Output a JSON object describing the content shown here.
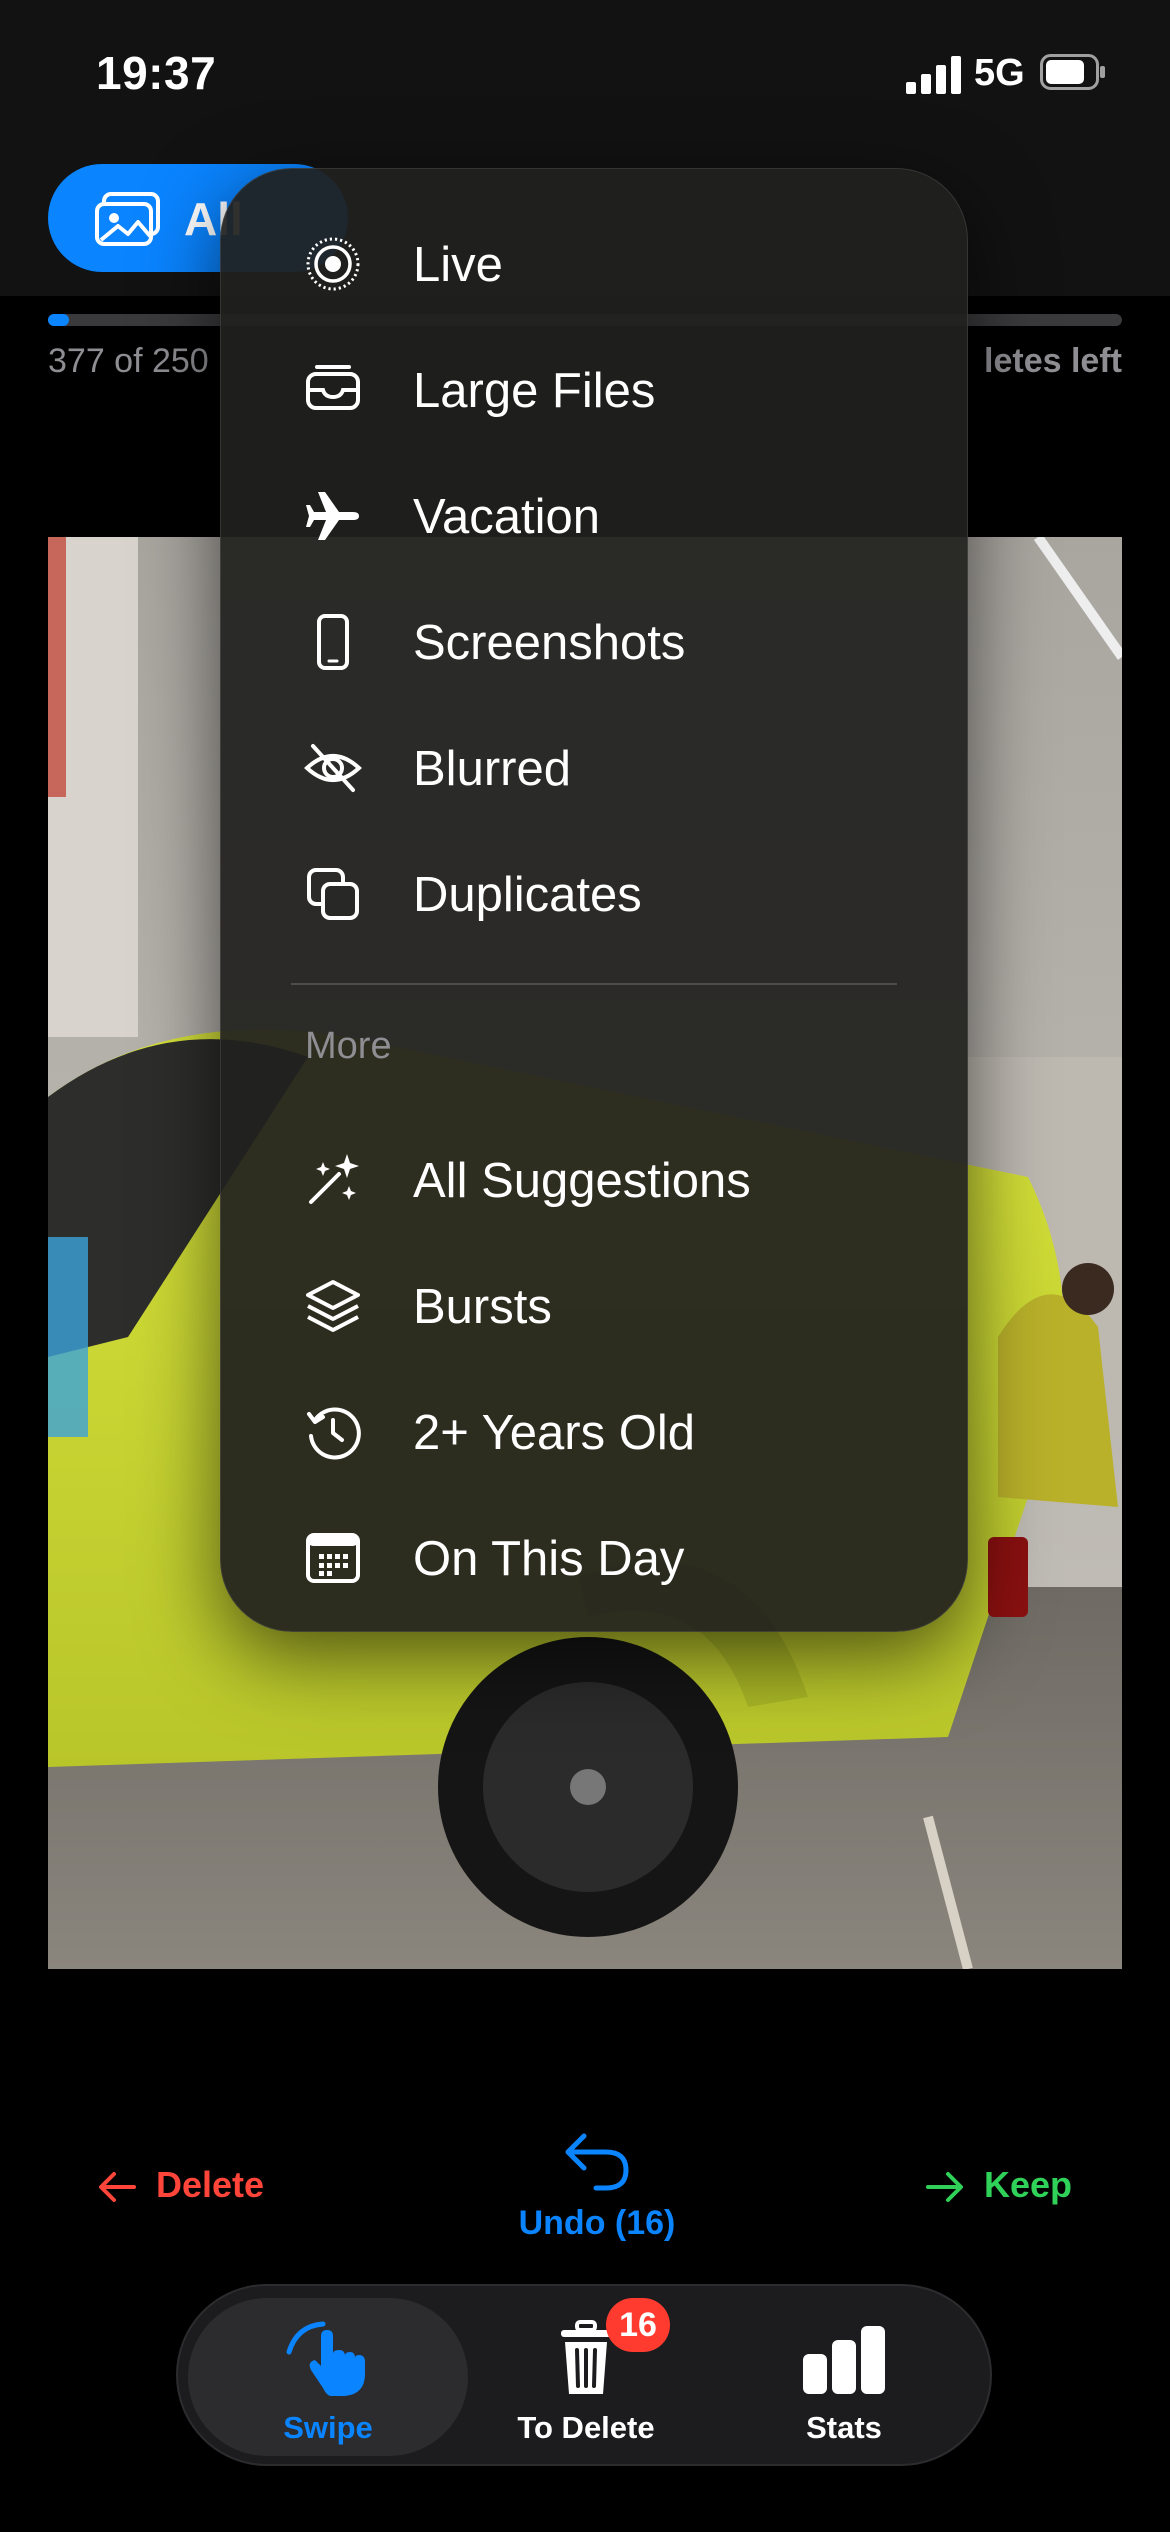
{
  "status_bar": {
    "time": "19:37",
    "network": "5G",
    "icons": [
      "signal-bars-icon",
      "battery-icon"
    ]
  },
  "filter_pill": {
    "label": "All",
    "icon": "photos-icon",
    "color": "#0a84ff"
  },
  "progress": {
    "text": "377 of 250",
    "fraction": 0.02,
    "right_text": "letes left"
  },
  "menu": {
    "items": [
      {
        "label": "Live",
        "icon": "live-photo-icon"
      },
      {
        "label": "Large Files",
        "icon": "tray-icon"
      },
      {
        "label": "Vacation",
        "icon": "airplane-icon"
      },
      {
        "label": "Screenshots",
        "icon": "phone-icon"
      },
      {
        "label": "Blurred",
        "icon": "eye-slash-icon"
      },
      {
        "label": "Duplicates",
        "icon": "duplicate-icon"
      }
    ],
    "section_title": "More",
    "more_items": [
      {
        "label": "All Suggestions",
        "icon": "sparkles-icon"
      },
      {
        "label": "Bursts",
        "icon": "layers-icon"
      },
      {
        "label": "2+ Years Old",
        "icon": "history-icon"
      },
      {
        "label": "On This Day",
        "icon": "calendar-icon"
      }
    ]
  },
  "actions": {
    "delete_label": "Delete",
    "keep_label": "Keep",
    "undo_label": "Undo (16)"
  },
  "tabbar": {
    "tabs": [
      {
        "label": "Swipe",
        "icon": "hand-swipe-icon",
        "selected": true
      },
      {
        "label": "To Delete",
        "icon": "trash-icon",
        "badge": "16"
      },
      {
        "label": "Stats",
        "icon": "bar-chart-icon"
      }
    ]
  },
  "colors": {
    "accent": "#0a84ff",
    "delete": "#ff453a",
    "keep": "#30d158",
    "badge": "#ff3b30"
  }
}
